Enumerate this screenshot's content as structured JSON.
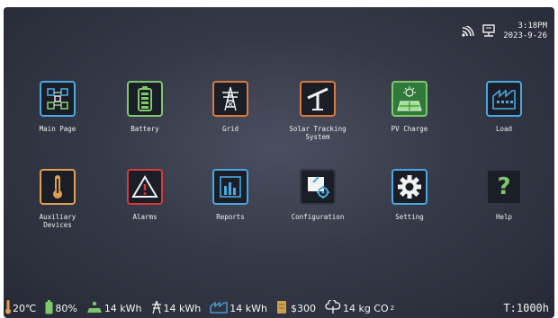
{
  "status": {
    "time": "3:18PM",
    "date": "2023-9-26",
    "icons": [
      "wifi-icon",
      "network-icon"
    ]
  },
  "tiles": [
    {
      "label": "Main Page",
      "icon": "network-nodes-icon",
      "border": "#4aa8e0"
    },
    {
      "label": "Battery",
      "icon": "battery-icon",
      "border": "#7cc86a"
    },
    {
      "label": "Grid",
      "icon": "power-tower-icon",
      "border": "#d97a40"
    },
    {
      "label": "Solar Tracking\nSystem",
      "icon": "solar-tracker-icon",
      "border": "#d97a40"
    },
    {
      "label": "PV Charge",
      "icon": "solar-panel-icon",
      "border": "#7cc86a"
    },
    {
      "label": "Load",
      "icon": "factory-icon",
      "border": "#4aa8e0"
    },
    {
      "label": "Auxiliary\nDevices",
      "icon": "thermometer-icon",
      "border": "#e0a050"
    },
    {
      "label": "Alarms",
      "icon": "warning-icon",
      "border": "#d83a3a"
    },
    {
      "label": "Reports",
      "icon": "bar-chart-icon",
      "border": "#4aa8e0"
    },
    {
      "label": "Configuration",
      "icon": "config-icon",
      "border": "#333744"
    },
    {
      "label": "Setting",
      "icon": "gear-icon",
      "border": "#4aa8e0"
    },
    {
      "label": "Help",
      "icon": "help-icon",
      "border": "#333744"
    }
  ],
  "bottom": {
    "temperature": "20℃",
    "battery": "80%",
    "pv_energy": "14 kWh",
    "grid_energy": "14 kWh",
    "load_energy": "14 kWh",
    "money": "$300",
    "co2_value": "14 kg CO",
    "co2_sub": "2",
    "timer": "T:1000h"
  }
}
